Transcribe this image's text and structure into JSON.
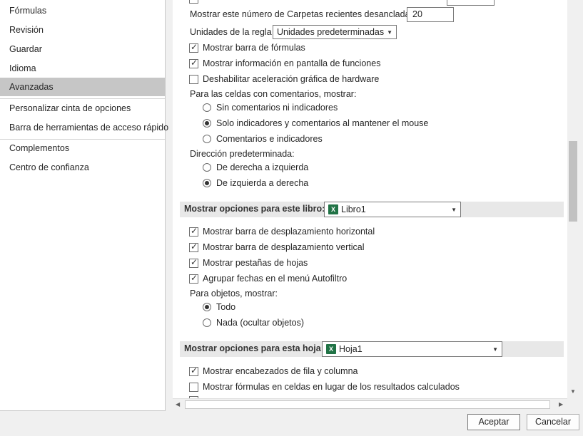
{
  "nav": {
    "items": [
      "Fórmulas",
      "Revisión",
      "Guardar",
      "Idioma",
      "Avanzadas",
      "Personalizar cinta de opciones",
      "Barra de herramientas de acceso rápido",
      "Complementos",
      "Centro de confianza"
    ],
    "active": "Avanzadas"
  },
  "settings": {
    "recent_folders_label": "Mostrar este número de Carpetas recientes desancladas:",
    "recent_folders_value": "20",
    "ruler_units_label": "Unidades de la regla",
    "ruler_units_value": "Unidades predeterminadas",
    "show_formula_bar": "Mostrar barra de fórmulas",
    "show_function_tooltips": "Mostrar información en pantalla de funciones",
    "disable_hw_accel": "Deshabilitar aceleración gráfica de hardware",
    "comments_heading": "Para las celdas con comentarios, mostrar:",
    "comments_opt1": "Sin comentarios ni indicadores",
    "comments_opt2": "Solo indicadores y comentarios al mantener el mouse",
    "comments_opt3": "Comentarios e indicadores",
    "direction_heading": "Dirección predeterminada:",
    "direction_opt1": "De derecha a izquierda",
    "direction_opt2": "De izquierda a derecha"
  },
  "book_section": {
    "title": "Mostrar opciones para este libro:",
    "workbook": "Libro1",
    "show_hscroll": "Mostrar barra de desplazamiento horizontal",
    "show_vscroll": "Mostrar barra de desplazamiento vertical",
    "show_sheet_tabs": "Mostrar pestañas de hojas",
    "group_dates": "Agrupar fechas en el menú Autofiltro",
    "objects_heading": "Para objetos, mostrar:",
    "objects_opt1": "Todo",
    "objects_opt2": "Nada (ocultar objetos)"
  },
  "sheet_section": {
    "title": "Mostrar opciones para esta hoja:",
    "sheet": "Hoja1",
    "show_headers": "Mostrar encabezados de fila y columna",
    "show_formulas": "Mostrar fórmulas en celdas en lugar de los resultados calculados"
  },
  "buttons": {
    "ok": "Aceptar",
    "cancel": "Cancelar"
  },
  "icons": {
    "checkmark": "✓",
    "excel": "X"
  }
}
